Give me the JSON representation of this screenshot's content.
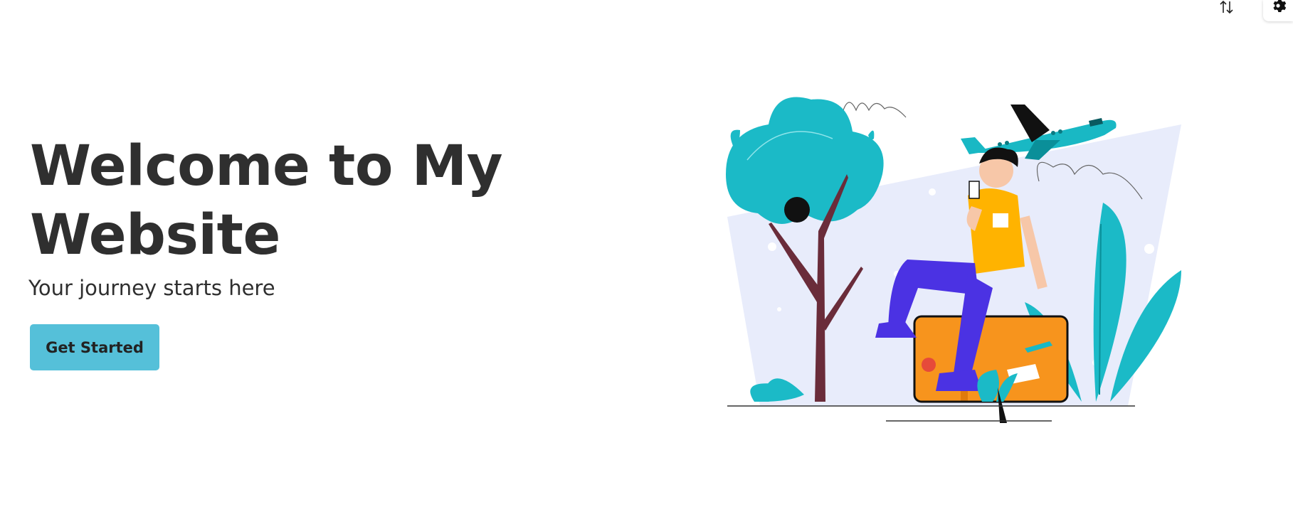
{
  "hero": {
    "title_line1": "Welcome to My",
    "title_line2": "Website",
    "subtitle": "Your journey starts here",
    "cta_label": "Get Started"
  },
  "toolbar": {
    "sort_icon": "sort-arrows-icon",
    "settings_icon": "gear-icon"
  },
  "illustration": {
    "subject": "traveler-sitting-on-suitcase",
    "colors": {
      "teal": "#19b8c4",
      "shirt": "#ffb300",
      "pants": "#4b32e3",
      "suitcase": "#f7941d",
      "sky": "#e8ecfb",
      "trunk": "#6a2c3a"
    }
  },
  "colors": {
    "accent": "#55c0d9",
    "text": "#2f2f2f"
  }
}
